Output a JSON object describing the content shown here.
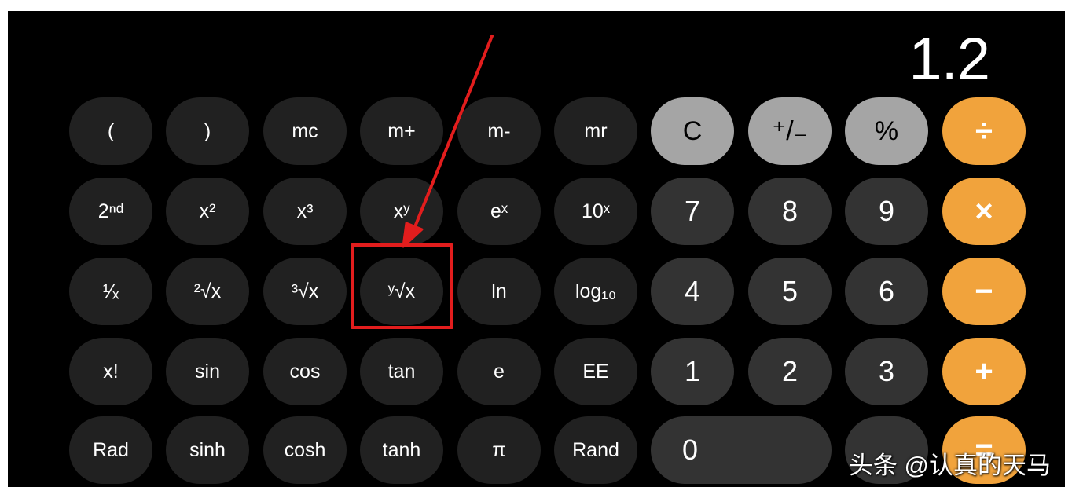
{
  "display": {
    "value": "1.2"
  },
  "keypad": {
    "row1": [
      {
        "label": "(",
        "kind": "sci"
      },
      {
        "label": ")",
        "kind": "sci"
      },
      {
        "label": "mc",
        "kind": "sci"
      },
      {
        "label": "m+",
        "kind": "sci"
      },
      {
        "label": "m-",
        "kind": "sci"
      },
      {
        "label": "mr",
        "kind": "sci"
      },
      {
        "label": "C",
        "kind": "func"
      },
      {
        "label": "⁺/₋",
        "kind": "func"
      },
      {
        "label": "%",
        "kind": "func"
      },
      {
        "label": "÷",
        "kind": "op"
      }
    ],
    "row2": [
      {
        "label": "2ⁿᵈ",
        "kind": "sci"
      },
      {
        "label": "x²",
        "kind": "sci"
      },
      {
        "label": "x³",
        "kind": "sci"
      },
      {
        "label": "xʸ",
        "kind": "sci"
      },
      {
        "label": "eˣ",
        "kind": "sci"
      },
      {
        "label": "10ˣ",
        "kind": "sci"
      },
      {
        "label": "7",
        "kind": "num"
      },
      {
        "label": "8",
        "kind": "num"
      },
      {
        "label": "9",
        "kind": "num"
      },
      {
        "label": "×",
        "kind": "op"
      }
    ],
    "row3": [
      {
        "label": "¹⁄ₓ",
        "kind": "sci"
      },
      {
        "label": "²√x",
        "kind": "sci"
      },
      {
        "label": "³√x",
        "kind": "sci"
      },
      {
        "label": "ʸ√x",
        "kind": "sci"
      },
      {
        "label": "ln",
        "kind": "sci"
      },
      {
        "label": "log₁₀",
        "kind": "sci"
      },
      {
        "label": "4",
        "kind": "num"
      },
      {
        "label": "5",
        "kind": "num"
      },
      {
        "label": "6",
        "kind": "num"
      },
      {
        "label": "−",
        "kind": "op"
      }
    ],
    "row4": [
      {
        "label": "x!",
        "kind": "sci"
      },
      {
        "label": "sin",
        "kind": "sci"
      },
      {
        "label": "cos",
        "kind": "sci"
      },
      {
        "label": "tan",
        "kind": "sci"
      },
      {
        "label": "e",
        "kind": "sci"
      },
      {
        "label": "EE",
        "kind": "sci"
      },
      {
        "label": "1",
        "kind": "num"
      },
      {
        "label": "2",
        "kind": "num"
      },
      {
        "label": "3",
        "kind": "num"
      },
      {
        "label": "+",
        "kind": "op"
      }
    ],
    "row5": [
      {
        "label": "Rad",
        "kind": "sci"
      },
      {
        "label": "sinh",
        "kind": "sci"
      },
      {
        "label": "cosh",
        "kind": "sci"
      },
      {
        "label": "tanh",
        "kind": "sci"
      },
      {
        "label": "π",
        "kind": "sci"
      },
      {
        "label": "Rand",
        "kind": "sci"
      },
      {
        "label": "0",
        "kind": "num"
      },
      {
        "label": ".",
        "kind": "num"
      },
      {
        "label": "=",
        "kind": "op"
      }
    ]
  },
  "annotation": {
    "highlighted_key": "ʸ√x",
    "color": "#e21d1d"
  },
  "colors": {
    "background": "#000000",
    "scientific_key": "#212121",
    "number_key": "#333333",
    "function_key": "#a5a5a5",
    "operator_key": "#f1a33c"
  },
  "watermark": {
    "text": "头条 @认真的天马"
  }
}
